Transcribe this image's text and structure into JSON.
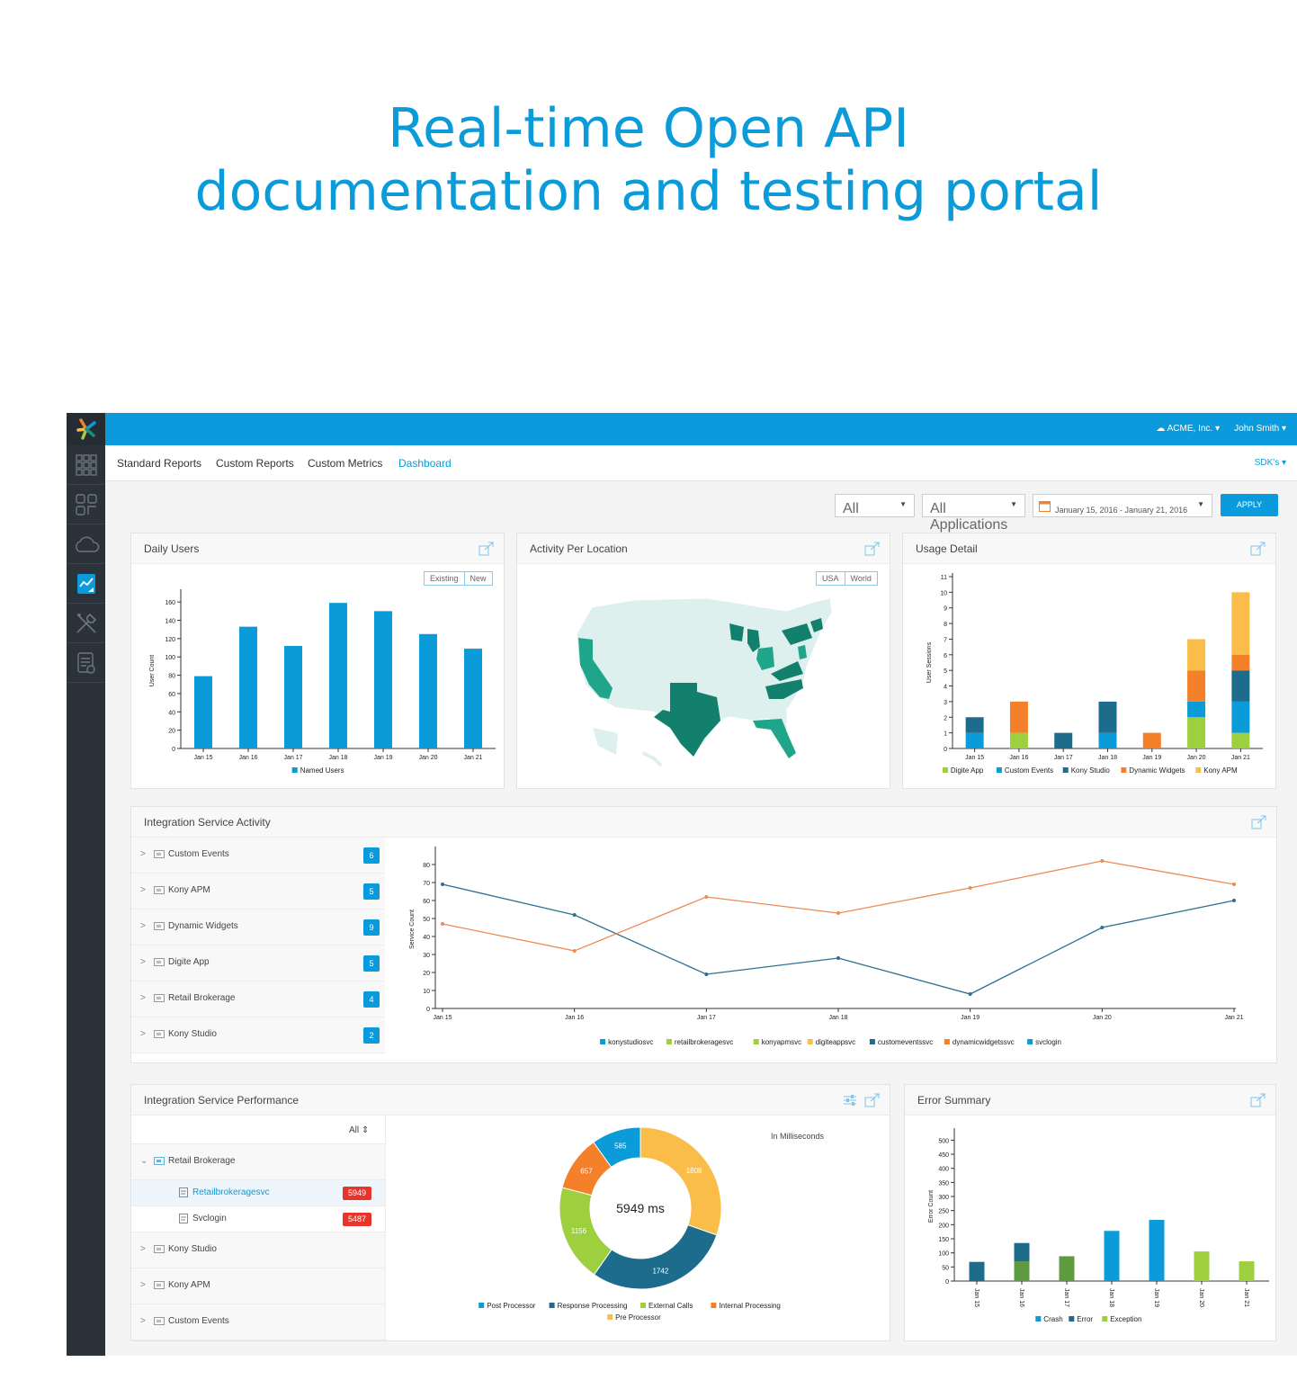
{
  "headline": {
    "line1": "Real-time Open API",
    "line2": "documentation and testing portal"
  },
  "colors": {
    "brand": "#0b9bdc",
    "headline": "#0a9bd8",
    "sidebar": "#2b323a",
    "error_badge": "#e8352b"
  },
  "sidebar": {
    "items": [
      {
        "icon": "grid-icon"
      },
      {
        "icon": "apps-icon"
      },
      {
        "icon": "cloud-icon"
      },
      {
        "icon": "analytics-icon",
        "active": true
      },
      {
        "icon": "tools-icon"
      },
      {
        "icon": "docs-icon"
      }
    ]
  },
  "topbar": {
    "account": "ACME, Inc. ▾",
    "user": "John Smith ▾"
  },
  "nav": {
    "tabs": [
      "Standard Reports",
      "Custom Reports",
      "Custom Metrics",
      "Dashboard"
    ],
    "active": "Dashboard",
    "sdk": "SDK's ▾"
  },
  "filters": {
    "filter1": "All",
    "filter2": "All Applications",
    "date_range": "January 15, 2016 - January 21, 2016",
    "apply": "APPLY"
  },
  "daily_users": {
    "title": "Daily Users",
    "toggle": [
      "Existing",
      "New"
    ],
    "chart_data": {
      "type": "bar",
      "categories": [
        "Jan 15",
        "Jan 16",
        "Jan 17",
        "Jan 18",
        "Jan 19",
        "Jan 20",
        "Jan 21"
      ],
      "series": [
        {
          "name": "Named Users",
          "values": [
            79,
            133,
            112,
            159,
            150,
            125,
            109
          ]
        }
      ],
      "ylabel": "User Count",
      "ylim": [
        0,
        170
      ],
      "yticks": [
        0,
        20,
        40,
        60,
        80,
        100,
        120,
        140,
        160
      ],
      "color": "#0a9bd8"
    }
  },
  "activity_location": {
    "title": "Activity Per Location",
    "toggle": [
      "USA",
      "World"
    ],
    "highlighted_states": [
      "California",
      "Texas",
      "Florida",
      "North Carolina",
      "Virginia",
      "Ohio",
      "Michigan",
      "Wisconsin",
      "New York",
      "Massachusetts",
      "Connecticut",
      "New Jersey"
    ],
    "colors": {
      "active": "#12907a",
      "light": "#4bbfa5",
      "base": "#ddf0ed"
    }
  },
  "usage_detail": {
    "title": "Usage Detail",
    "chart_data": {
      "type": "bar",
      "stacked": true,
      "categories": [
        "Jan 15",
        "Jan 16",
        "Jan 17",
        "Jan 18",
        "Jan 19",
        "Jan 20",
        "Jan 21"
      ],
      "series": [
        {
          "name": "Digite App",
          "color": "#9dcf3f",
          "values": [
            0,
            1,
            0,
            0,
            0,
            2,
            1
          ]
        },
        {
          "name": "Custom Events",
          "color": "#0a9bd8",
          "values": [
            1,
            0,
            0,
            1,
            0,
            1,
            2
          ]
        },
        {
          "name": "Kony Studio",
          "color": "#1d6c8c",
          "values": [
            1,
            0,
            1,
            2,
            0,
            0,
            2
          ]
        },
        {
          "name": "Dynamic Widgets",
          "color": "#f5802a",
          "values": [
            0,
            2,
            0,
            0,
            1,
            2,
            1
          ]
        },
        {
          "name": "Kony APM",
          "color": "#fbbd4a",
          "values": [
            0,
            0,
            0,
            0,
            0,
            2,
            4
          ]
        }
      ],
      "ylabel": "User Sessions",
      "ylim": [
        0,
        11
      ],
      "yticks": [
        0,
        1,
        2,
        3,
        4,
        5,
        6,
        7,
        8,
        9,
        10,
        11
      ]
    }
  },
  "integration_activity": {
    "title": "Integration Service Activity",
    "services": [
      {
        "label": "Custom Events",
        "count": "6"
      },
      {
        "label": "Kony APM",
        "count": "5"
      },
      {
        "label": "Dynamic Widgets",
        "count": "9"
      },
      {
        "label": "Digite App",
        "count": "5"
      },
      {
        "label": "Retail Brokerage",
        "count": "4"
      },
      {
        "label": "Kony Studio",
        "count": "2"
      }
    ],
    "chart_data": {
      "type": "line",
      "categories": [
        "Jan 15",
        "Jan 16",
        "Jan 17",
        "Jan 18",
        "Jan 19",
        "Jan 20",
        "Jan 21"
      ],
      "series": [
        {
          "color": "#2e6f91",
          "values": [
            69,
            52,
            19,
            28,
            8,
            45,
            60
          ]
        },
        {
          "color": "#ec8b52",
          "values": [
            47,
            32,
            62,
            53,
            67,
            82,
            69
          ]
        }
      ],
      "ylabel": "Service Count",
      "ylim": [
        0,
        88
      ],
      "yticks": [
        0,
        10,
        20,
        30,
        40,
        50,
        60,
        70,
        80
      ],
      "legend": [
        {
          "name": "konystudiosvc",
          "color": "#0a9bd8"
        },
        {
          "name": "retailbrokeragesvc",
          "color": "#9dcf3f"
        },
        {
          "name": "konyapmsvc",
          "color": "#9dcf3f"
        },
        {
          "name": "digiteappsvc",
          "color": "#fbbd4a"
        },
        {
          "name": "customeventssvc",
          "color": "#1d6c8c"
        },
        {
          "name": "dynamicwidgetssvc",
          "color": "#f5802a"
        },
        {
          "name": "svclogin",
          "color": "#0a9bd8"
        }
      ]
    }
  },
  "integration_performance": {
    "title": "Integration Service Performance",
    "filter": "All",
    "tree": {
      "group": "Retail Brokerage",
      "children": [
        {
          "label": "Retailbrokeragesvc",
          "value": "5949"
        },
        {
          "label": "Svclogin",
          "value": "5487"
        }
      ],
      "others": [
        "Kony Studio",
        "Kony APM",
        "Custom Events"
      ]
    },
    "unit_note": "In Milliseconds",
    "center_label": "5949 ms",
    "chart_data": {
      "type": "pie",
      "donut": true,
      "slices": [
        {
          "name": "Pre Processor",
          "value": 1808,
          "color": "#fbbd4a"
        },
        {
          "name": "Response Processing",
          "value": 1742,
          "color": "#1d6c8c"
        },
        {
          "name": "External Calls",
          "value": 1156,
          "color": "#9dcf3f"
        },
        {
          "name": "Internal Processing",
          "value": 657,
          "color": "#f5802a"
        },
        {
          "name": "Post Processor",
          "value": 585,
          "color": "#0a9bd8"
        }
      ],
      "legend": [
        {
          "name": "Post Processor",
          "color": "#0a9bd8"
        },
        {
          "name": "Response Processing",
          "color": "#1d6c8c"
        },
        {
          "name": "External Calls",
          "color": "#9dcf3f"
        },
        {
          "name": "Internal Processing",
          "color": "#f5802a"
        },
        {
          "name": "Pre Processor",
          "color": "#fbbd4a"
        }
      ]
    }
  },
  "error_summary": {
    "title": "Error Summary",
    "chart_data": {
      "type": "bar",
      "stacked": true,
      "categories": [
        "Jan 15",
        "Jan 16",
        "Jan 17",
        "Jan 18",
        "Jan 19",
        "Jan 20",
        "Jan 21"
      ],
      "series": [
        {
          "name": "Exception",
          "color": "#9dcf3f",
          "values": [
            0,
            0,
            0,
            0,
            0,
            105,
            70
          ]
        },
        {
          "name": "Exception-dark",
          "color": "#5e9a3f",
          "values": [
            0,
            70,
            88,
            0,
            0,
            0,
            0
          ]
        },
        {
          "name": "Error",
          "color": "#1d6c8c",
          "values": [
            68,
            65,
            0,
            0,
            0,
            0,
            0
          ]
        },
        {
          "name": "Crash",
          "color": "#0a9bd8",
          "values": [
            0,
            0,
            0,
            178,
            217,
            0,
            0
          ]
        }
      ],
      "legend": [
        {
          "name": "Crash",
          "color": "#0a9bd8"
        },
        {
          "name": "Error",
          "color": "#1d6c8c"
        },
        {
          "name": "Exception",
          "color": "#9dcf3f"
        }
      ],
      "ylabel": "Error Count",
      "ylim": [
        0,
        530
      ],
      "yticks": [
        0,
        50,
        100,
        150,
        200,
        250,
        300,
        350,
        400,
        450,
        500
      ]
    }
  }
}
